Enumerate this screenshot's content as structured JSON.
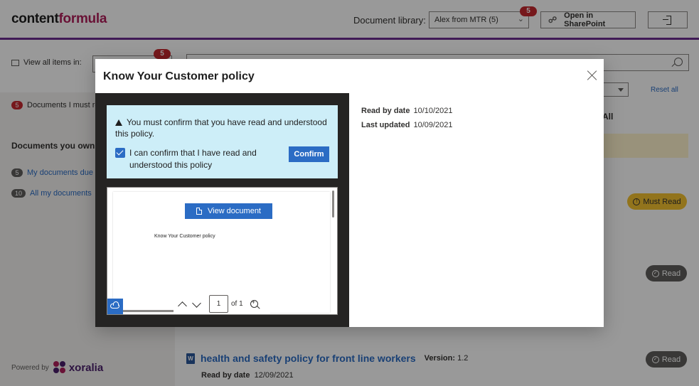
{
  "header": {
    "brand_part1": "content",
    "brand_part2": "formula",
    "doclib_label": "Document library:",
    "doclib_value": "Alex from MTR (5)",
    "doclib_badge": "5",
    "sharepoint_label": "Open in SharePoint"
  },
  "toolbar": {
    "view_all_label": "View all items in:",
    "view_badge": "5",
    "reset_all": "Reset all",
    "all_tab": "All"
  },
  "sidebar": {
    "must_read_count": "5",
    "must_read_label": "Documents I must re",
    "own_heading": "Documents you own",
    "items": [
      {
        "count": "5",
        "label": "My documents due f"
      },
      {
        "count": "10",
        "label": "All my documents"
      }
    ],
    "powered_by": "Powered by",
    "powered_brand": "xoralia"
  },
  "list": {
    "must_read_badge": "Must Read",
    "read_badge_1": "Read",
    "read_badge_2": "Read",
    "doc_title": "health and safety policy for front line workers",
    "version_label": "Version:",
    "version_value": "1.2",
    "read_by_label": "Read by date",
    "read_by_value": "12/09/2021"
  },
  "modal": {
    "title": "Know Your Customer policy",
    "warning": "You must confirm that you have read and understood this policy.",
    "checkbox_label": "I can confirm that I have read and understood this policy",
    "checkbox_checked": true,
    "confirm_button": "Confirm",
    "view_document_button": "View document",
    "preview_text": "Know Your Customer policy",
    "page_current": "1",
    "page_of": "of 1",
    "read_by_label": "Read by date",
    "read_by_value": "10/10/2021",
    "last_updated_label": "Last updated",
    "last_updated_value": "10/09/2021"
  },
  "colors": {
    "accent": "#2b6cc4",
    "brand_underline": "#6b2c8f",
    "badge_red": "#c5292f",
    "must_read_yellow": "#f3c130",
    "confirm_panel": "#cdeef8"
  }
}
